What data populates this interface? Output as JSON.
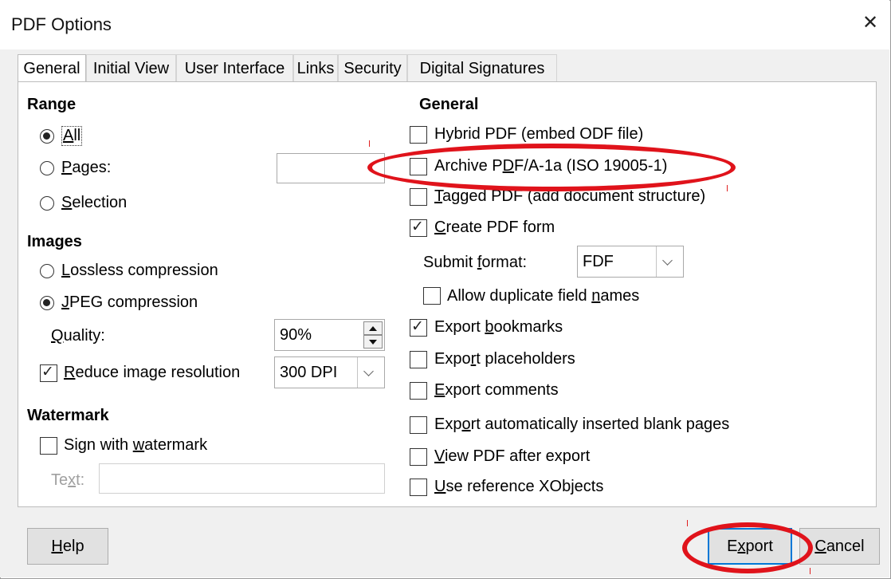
{
  "window": {
    "title": "PDF Options"
  },
  "tabs": [
    "General",
    "Initial View",
    "User Interface",
    "Links",
    "Security",
    "Digital Signatures"
  ],
  "range": {
    "heading": "Range",
    "all": {
      "pre": "",
      "ul": "A",
      "post": "ll"
    },
    "pages": {
      "pre": "",
      "ul": "P",
      "post": "ages:"
    },
    "selection": {
      "pre": "",
      "ul": "S",
      "post": "election"
    },
    "selected": "All",
    "pages_value": ""
  },
  "images": {
    "heading": "Images",
    "lossless": {
      "pre": "",
      "ul": "L",
      "post": "ossless compression"
    },
    "jpeg": {
      "pre": "",
      "ul": "J",
      "post": "PEG compression"
    },
    "selected": "JPEG compression",
    "quality": {
      "pre": "",
      "ul": "Q",
      "post": "uality:"
    },
    "quality_value": "90%",
    "reduce": {
      "pre": "",
      "ul": "R",
      "post": "educe image resolution"
    },
    "reduce_checked": true,
    "resolution_value": "300 DPI"
  },
  "watermark": {
    "heading": "Watermark",
    "sign": {
      "pre": "Sign with ",
      "ul": "w",
      "post": "atermark"
    },
    "sign_checked": false,
    "text": {
      "pre": "Te",
      "ul": "x",
      "post": "t:"
    },
    "text_value": ""
  },
  "general": {
    "heading": "General",
    "hybrid": {
      "label": "Hybrid PDF (embed ODF file)",
      "checked": false
    },
    "archive": {
      "pre": "Archive P",
      "ul": "D",
      "post": "F/A-1a (ISO 19005-1)",
      "checked": false
    },
    "tagged": {
      "pre": "",
      "ul": "T",
      "post": "agged PDF (add document structure)",
      "checked": false
    },
    "create_form": {
      "pre": "",
      "ul": "C",
      "post": "reate PDF form",
      "checked": true
    },
    "submit_format": {
      "pre": "Submit ",
      "ul": "f",
      "post": "ormat:"
    },
    "submit_format_value": "FDF",
    "allow_duplicate": {
      "pre": "Allow duplicate field ",
      "ul": "n",
      "post": "ames",
      "checked": false
    },
    "bookmarks": {
      "pre": "Export ",
      "ul": "b",
      "post": "ookmarks",
      "checked": true
    },
    "placeholders": {
      "pre": "Expo",
      "ul": "r",
      "post": "t placeholders",
      "checked": false
    },
    "comments": {
      "pre": "",
      "ul": "E",
      "post": "xport comments",
      "checked": false
    },
    "blank_pages": {
      "pre": "Exp",
      "ul": "o",
      "post": "rt automatically inserted blank pages",
      "checked": false
    },
    "view_after": {
      "pre": "",
      "ul": "V",
      "post": "iew PDF after export",
      "checked": false
    },
    "xobjects": {
      "pre": "",
      "ul": "U",
      "post": "se reference XObjects",
      "checked": false
    }
  },
  "buttons": {
    "help": {
      "pre": "",
      "ul": "H",
      "post": "elp"
    },
    "export": {
      "pre": "E",
      "ul": "x",
      "post": "port"
    },
    "cancel": {
      "pre": "",
      "ul": "C",
      "post": "ancel"
    }
  },
  "colors": {
    "annotation": "#e0131b",
    "default_button_border": "#0078d7"
  }
}
